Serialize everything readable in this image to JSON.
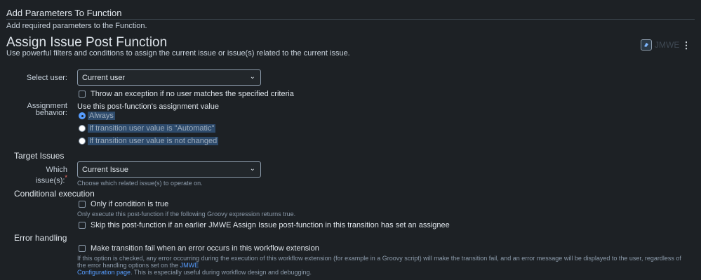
{
  "header": {
    "title": "Add Parameters To Function",
    "description": "Add required parameters to the Function."
  },
  "main": {
    "title": "Assign Issue Post Function",
    "description": "Use powerful filters and conditions to assign the current issue or issue(s) related to the current issue.",
    "app_label": "JMWE",
    "more_icon": "⋮"
  },
  "select_user": {
    "label": "Select user:",
    "value": "Current user",
    "exception_checkbox": "Throw an exception if no user matches the specified criteria"
  },
  "assignment": {
    "label_line1": "Assignment",
    "label_line2": "behavior:",
    "heading": "Use this post-function's assignment value",
    "options": [
      {
        "label": "Always",
        "selected": true
      },
      {
        "label": "If transition user value is \"Automatic\"",
        "selected": false
      },
      {
        "label": "If transition user value is not changed",
        "selected": false
      }
    ]
  },
  "target": {
    "section": "Target Issues",
    "label": "Which issue(s):",
    "required_mark": "*",
    "value": "Current Issue",
    "help": "Choose which related issue(s) to operate on."
  },
  "conditional": {
    "section": "Conditional execution",
    "checkbox": "Only if condition is true",
    "help": "Only execute this post-function if the following Groovy expression returns true.",
    "skip_checkbox": "Skip this post-function if an earlier JMWE Assign Issue post-function in this transition has set an assignee"
  },
  "error": {
    "section": "Error handling",
    "checkbox": "Make transition fail when an error occurs in this workflow extension",
    "help_part1": "If this option is checked, any error occurring during the execution of this workflow extension (for example in a Groovy script) will make the transition fail, and an error message will be displayed to the user, regardless of the error handling options set on the",
    "help_link_a": "JMWE",
    "help_link_b": "Configuration page",
    "help_part2": ". This is especially useful during workflow design and debugging."
  },
  "colors": {
    "background": "#1d2125",
    "accent": "#579dff",
    "required": "#f87168"
  }
}
